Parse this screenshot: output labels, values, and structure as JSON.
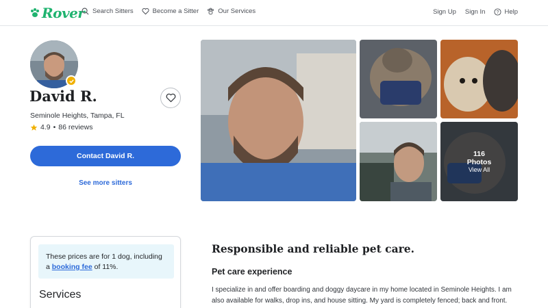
{
  "header": {
    "logo_text": "Rover",
    "nav": [
      {
        "label": "Search Sitters",
        "icon": "search-icon"
      },
      {
        "label": "Become a Sitter",
        "icon": "heart-icon"
      },
      {
        "label": "Our Services",
        "icon": "paw-icon"
      }
    ],
    "sign_up": "Sign Up",
    "sign_in": "Sign In",
    "help": "Help"
  },
  "profile": {
    "name": "David R.",
    "location": "Seminole Heights, Tampa, FL",
    "rating": "4.9",
    "separator": "•",
    "reviews": "86 reviews",
    "contact_label": "Contact David R.",
    "see_more_label": "See more sitters"
  },
  "photos": {
    "count": "116",
    "label": "Photos",
    "view_all": "View All"
  },
  "services_card": {
    "note_prefix": "These prices are for 1 dog, including a ",
    "note_link": "booking fee",
    "note_suffix": " of 11%.",
    "title": "Services"
  },
  "about": {
    "title": "Responsible and reliable pet care.",
    "exp_title": "Pet care experience",
    "exp_text": "I specialize in and offer boarding and doggy daycare in my home located in Seminole Heights. I am also available for walks, drop ins, and house sitting. My yard is completely fenced; back and front."
  },
  "colors": {
    "brand": "#1fb36f",
    "accent": "#2d6ad9",
    "star": "#f0b000"
  }
}
